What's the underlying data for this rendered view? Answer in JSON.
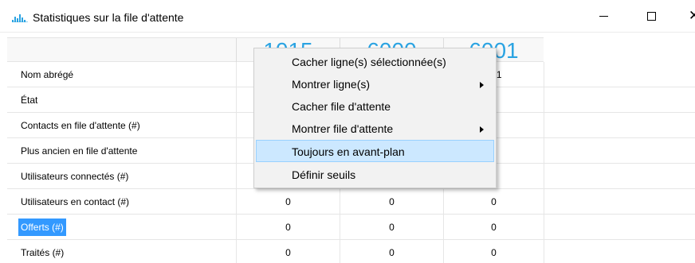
{
  "window": {
    "title": "Statistiques sur la file d'attente",
    "icon": "bar-chart-icon",
    "accent_color": "#2aa3e2",
    "close_glyph": "✕"
  },
  "columns": [
    "1015",
    "6000",
    "6001"
  ],
  "rows": [
    {
      "label": "Nom abrégé",
      "values": [
        "",
        "",
        "001"
      ]
    },
    {
      "label": "État",
      "values": [
        "",
        "",
        "ır"
      ]
    },
    {
      "label": "Contacts en file d'attente (#)",
      "values": [
        "",
        "",
        ""
      ]
    },
    {
      "label": "Plus ancien en file d'attente",
      "values": [
        "",
        "",
        ""
      ]
    },
    {
      "label": "Utilisateurs connectés (#)",
      "values": [
        "",
        "",
        "I"
      ]
    },
    {
      "label": "Utilisateurs en contact (#)",
      "values": [
        "0",
        "0",
        "0"
      ]
    },
    {
      "label": "Offerts (#)",
      "values": [
        "0",
        "0",
        "0"
      ],
      "selected": true
    },
    {
      "label": "Traités (#)",
      "values": [
        "0",
        "0",
        "0"
      ]
    }
  ],
  "context_menu": {
    "items": [
      {
        "label": "Cacher ligne(s) sélectionnée(s)",
        "submenu": false,
        "highlighted": false
      },
      {
        "label": "Montrer ligne(s)",
        "submenu": true,
        "highlighted": false
      },
      {
        "label": "Cacher file d'attente",
        "submenu": false,
        "highlighted": false
      },
      {
        "label": "Montrer file d'attente",
        "submenu": true,
        "highlighted": false
      },
      {
        "label": "Toujours en avant-plan",
        "submenu": false,
        "highlighted": true
      },
      {
        "label": "Définir seuils",
        "submenu": false,
        "highlighted": false
      }
    ],
    "highlight_color": "#cce8ff",
    "selection_color": "#3399ff"
  }
}
